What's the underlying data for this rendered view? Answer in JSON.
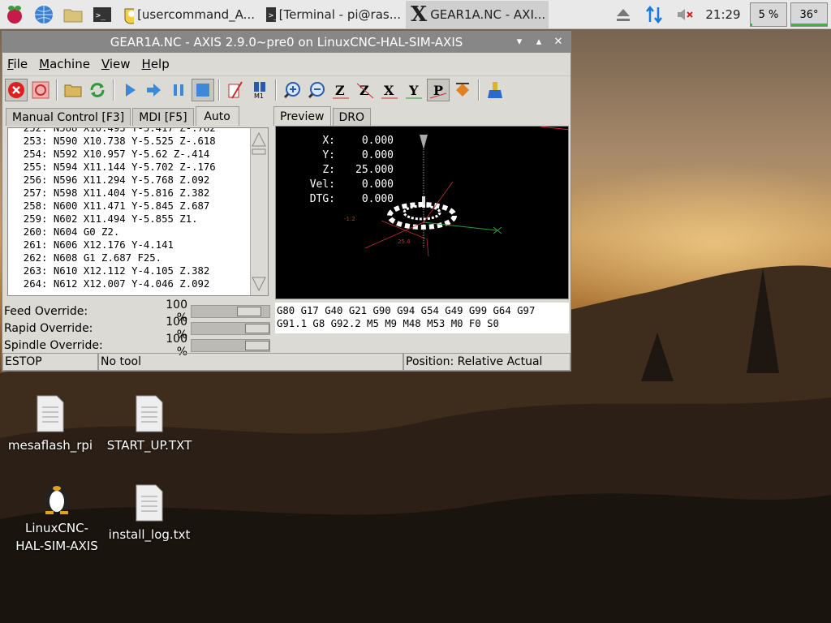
{
  "taskbar": {
    "tasks": [
      {
        "label": "[usercommand_A..."
      },
      {
        "label": "[Terminal - pi@ras..."
      },
      {
        "label": "GEAR1A.NC - AXI..."
      }
    ],
    "clock": "21:29",
    "cpu": "5 %",
    "temp": "36°",
    "cpu_fraction": 0.05
  },
  "window": {
    "title": "GEAR1A.NC - AXIS 2.9.0~pre0 on LinuxCNC-HAL-SIM-AXIS",
    "menu": [
      "File",
      "Machine",
      "View",
      "Help"
    ],
    "tabs_left": [
      "Manual Control [F3]",
      "MDI [F5]",
      "Auto"
    ],
    "tabs_right": [
      "Preview",
      "DRO"
    ],
    "gcode_lines": [
      "252: N588 X10.493 Y-5.417 Z-.782",
      "253: N590 X10.738 Y-5.525 Z-.618",
      "254: N592 X10.957 Y-5.62 Z-.414",
      "255: N594 X11.144 Y-5.702 Z-.176",
      "256: N596 X11.294 Y-5.768 Z.092",
      "257: N598 X11.404 Y-5.816 Z.382",
      "258: N600 X11.471 Y-5.845 Z.687",
      "259: N602 X11.494 Y-5.855 Z1.",
      "260: N604 G0 Z2.",
      "261: N606 X12.176 Y-4.141",
      "262: N608 G1 Z.687 F25.",
      "263: N610 X12.112 Y-4.105 Z.382",
      "264: N612 X12.007 Y-4.046 Z.092"
    ],
    "dro": [
      {
        "label": "X:",
        "value": "0.000"
      },
      {
        "label": "Y:",
        "value": "0.000"
      },
      {
        "label": "Z:",
        "value": "25.000"
      },
      {
        "label": "Vel:",
        "value": "0.000"
      },
      {
        "label": "DTG:",
        "value": "0.000"
      }
    ],
    "active_codes": {
      "line1": "G80 G17 G40 G21 G90 G94 G54 G49 G99 G64 G97",
      "line2": "G91.1 G8 G92.2 M5 M9 M48 M53 M0 F0 S0"
    },
    "overrides": [
      {
        "label": "Feed Override:",
        "value": "100 %",
        "fraction": 0.85
      },
      {
        "label": "Rapid Override:",
        "value": "100 %",
        "fraction": 1.0
      },
      {
        "label": "Spindle Override:",
        "value": "100 %",
        "fraction": 1.0
      }
    ],
    "status": {
      "estop": "ESTOP",
      "tool": "No tool",
      "position": "Position: Relative Actual"
    }
  },
  "desktop_icons": [
    {
      "label": "mesaflash_rpi"
    },
    {
      "label": "START_UP.TXT"
    },
    {
      "label": "LinuxCNC-HAL-SIM-AXIS"
    },
    {
      "label": "install_log.txt"
    }
  ]
}
